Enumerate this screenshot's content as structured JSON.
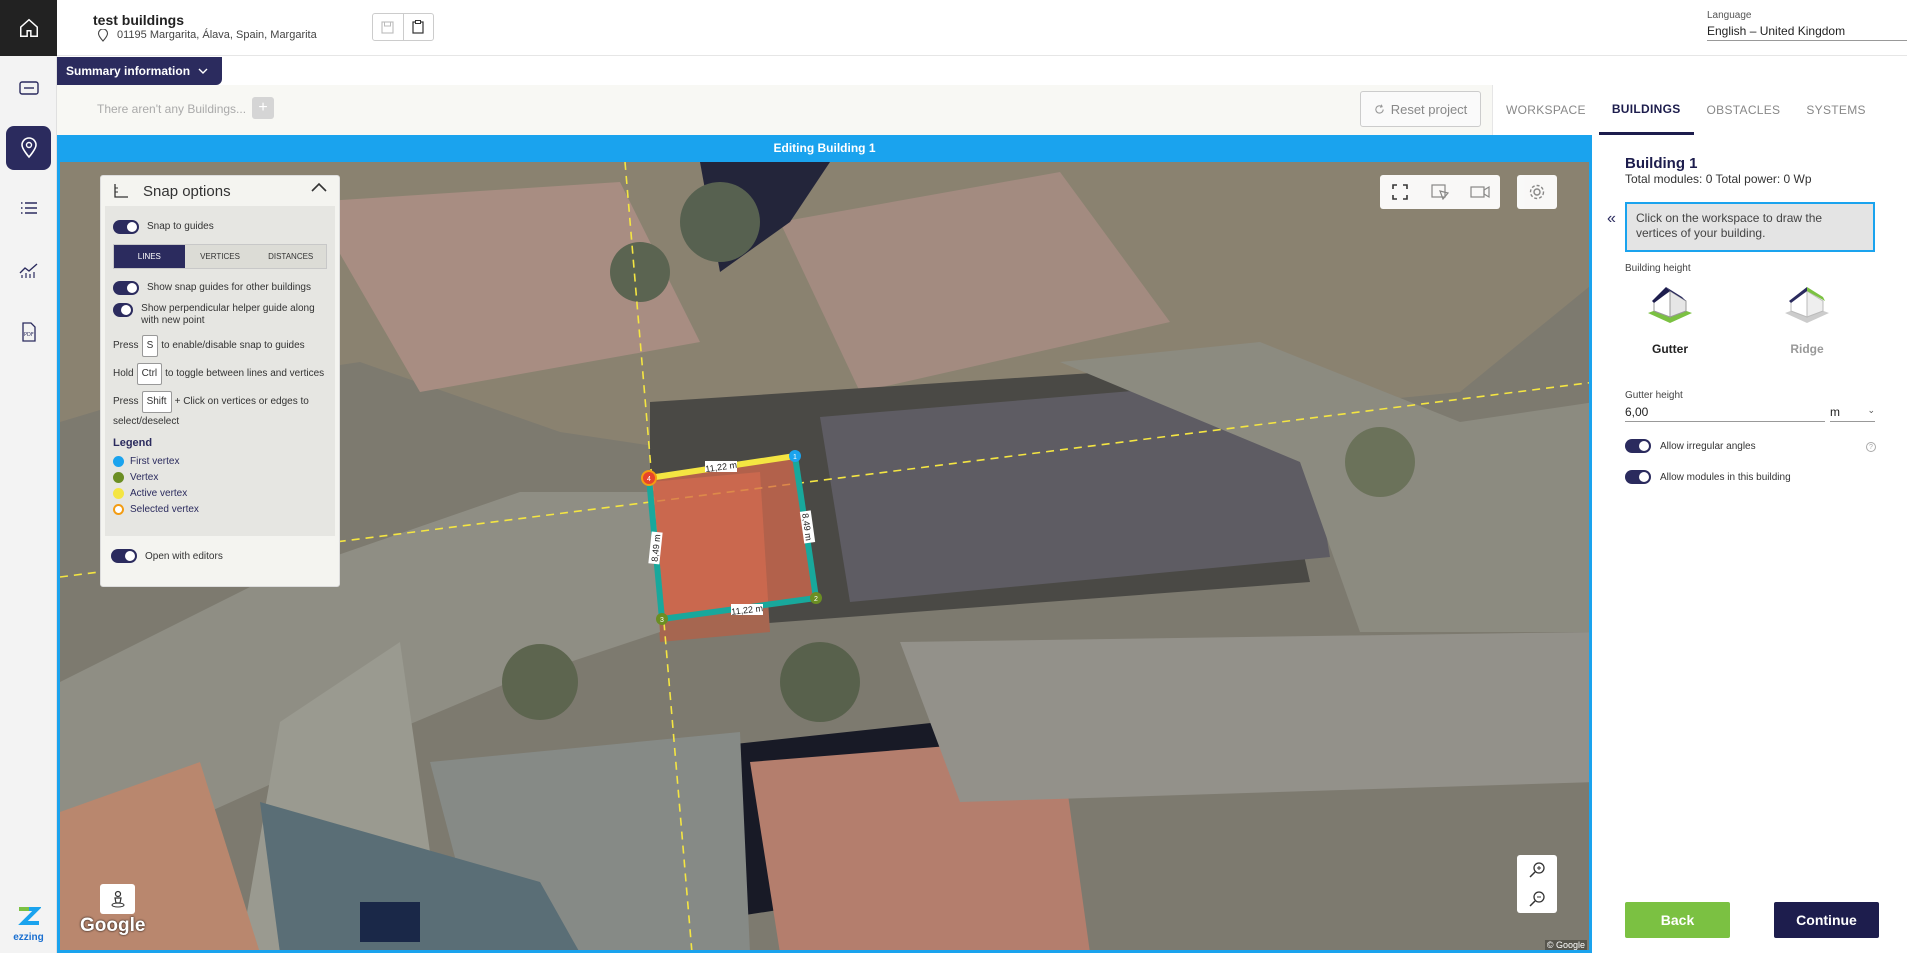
{
  "brand": {
    "name": "ezzing",
    "accent": "#2b2b5e",
    "highlight": "#1aa3ee"
  },
  "project": {
    "title": "test buildings",
    "address": "01195 Margarita, Álava, Spain, Margarita"
  },
  "language": {
    "label": "Language",
    "value": "English – United Kingdom"
  },
  "summary_button": "Summary information",
  "buildings_empty": "There aren't any Buildings...",
  "plus_label": "+",
  "reset_button": "Reset project",
  "tabs": [
    {
      "label": "WORKSPACE",
      "active": false
    },
    {
      "label": "BUILDINGS",
      "active": true
    },
    {
      "label": "OBSTACLES",
      "active": false
    },
    {
      "label": "SYSTEMS",
      "active": false
    }
  ],
  "editing_banner": "Editing Building 1",
  "snap": {
    "title": "Snap options",
    "snap_to_guides": "Snap to guides",
    "modes": [
      "LINES",
      "VERTICES",
      "DISTANCES"
    ],
    "active_mode": "LINES",
    "show_guides": "Show snap guides for other buildings",
    "perp_helper": "Show perpendicular helper guide along with new point",
    "hint1_pre": "Press",
    "hint1_key": "S",
    "hint1_post": "to enable/disable snap to guides",
    "hint2_pre": "Hold",
    "hint2_key": "Ctrl",
    "hint2_post": "to toggle between lines and vertices",
    "hint3_pre": "Press",
    "hint3_key": "Shift",
    "hint3_post": "+ Click on vertices or edges to select/deselect",
    "legend_title": "Legend",
    "legend": [
      {
        "label": "First vertex",
        "color": "#1aa3ee"
      },
      {
        "label": "Vertex",
        "color": "#6b8e23"
      },
      {
        "label": "Active vertex",
        "color": "#f4e542"
      },
      {
        "label": "Selected vertex",
        "color": "#f39c12"
      }
    ],
    "open_with_editors": "Open with editors"
  },
  "polygon": {
    "edges": [
      "11,22 m",
      "8,49 m",
      "11,22 m",
      "8,49 m"
    ],
    "vertices": [
      "1",
      "2",
      "3",
      "4"
    ]
  },
  "map": {
    "logo": "Google",
    "copyright": "© Google"
  },
  "panel": {
    "building_title": "Building 1",
    "totals": "Total modules: 0 Total power: 0 Wp",
    "info": "Click on the workspace to draw the vertices of your building.",
    "height_label": "Building height",
    "roof_types": [
      {
        "label": "Gutter",
        "active": true
      },
      {
        "label": "Ridge",
        "active": false
      }
    ],
    "gutter_height_label": "Gutter height",
    "gutter_height_value": "6,00",
    "unit": "m",
    "allow_irregular": "Allow irregular angles",
    "allow_modules": "Allow modules in this building",
    "help": "?",
    "back": "Back",
    "continue": "Continue"
  }
}
